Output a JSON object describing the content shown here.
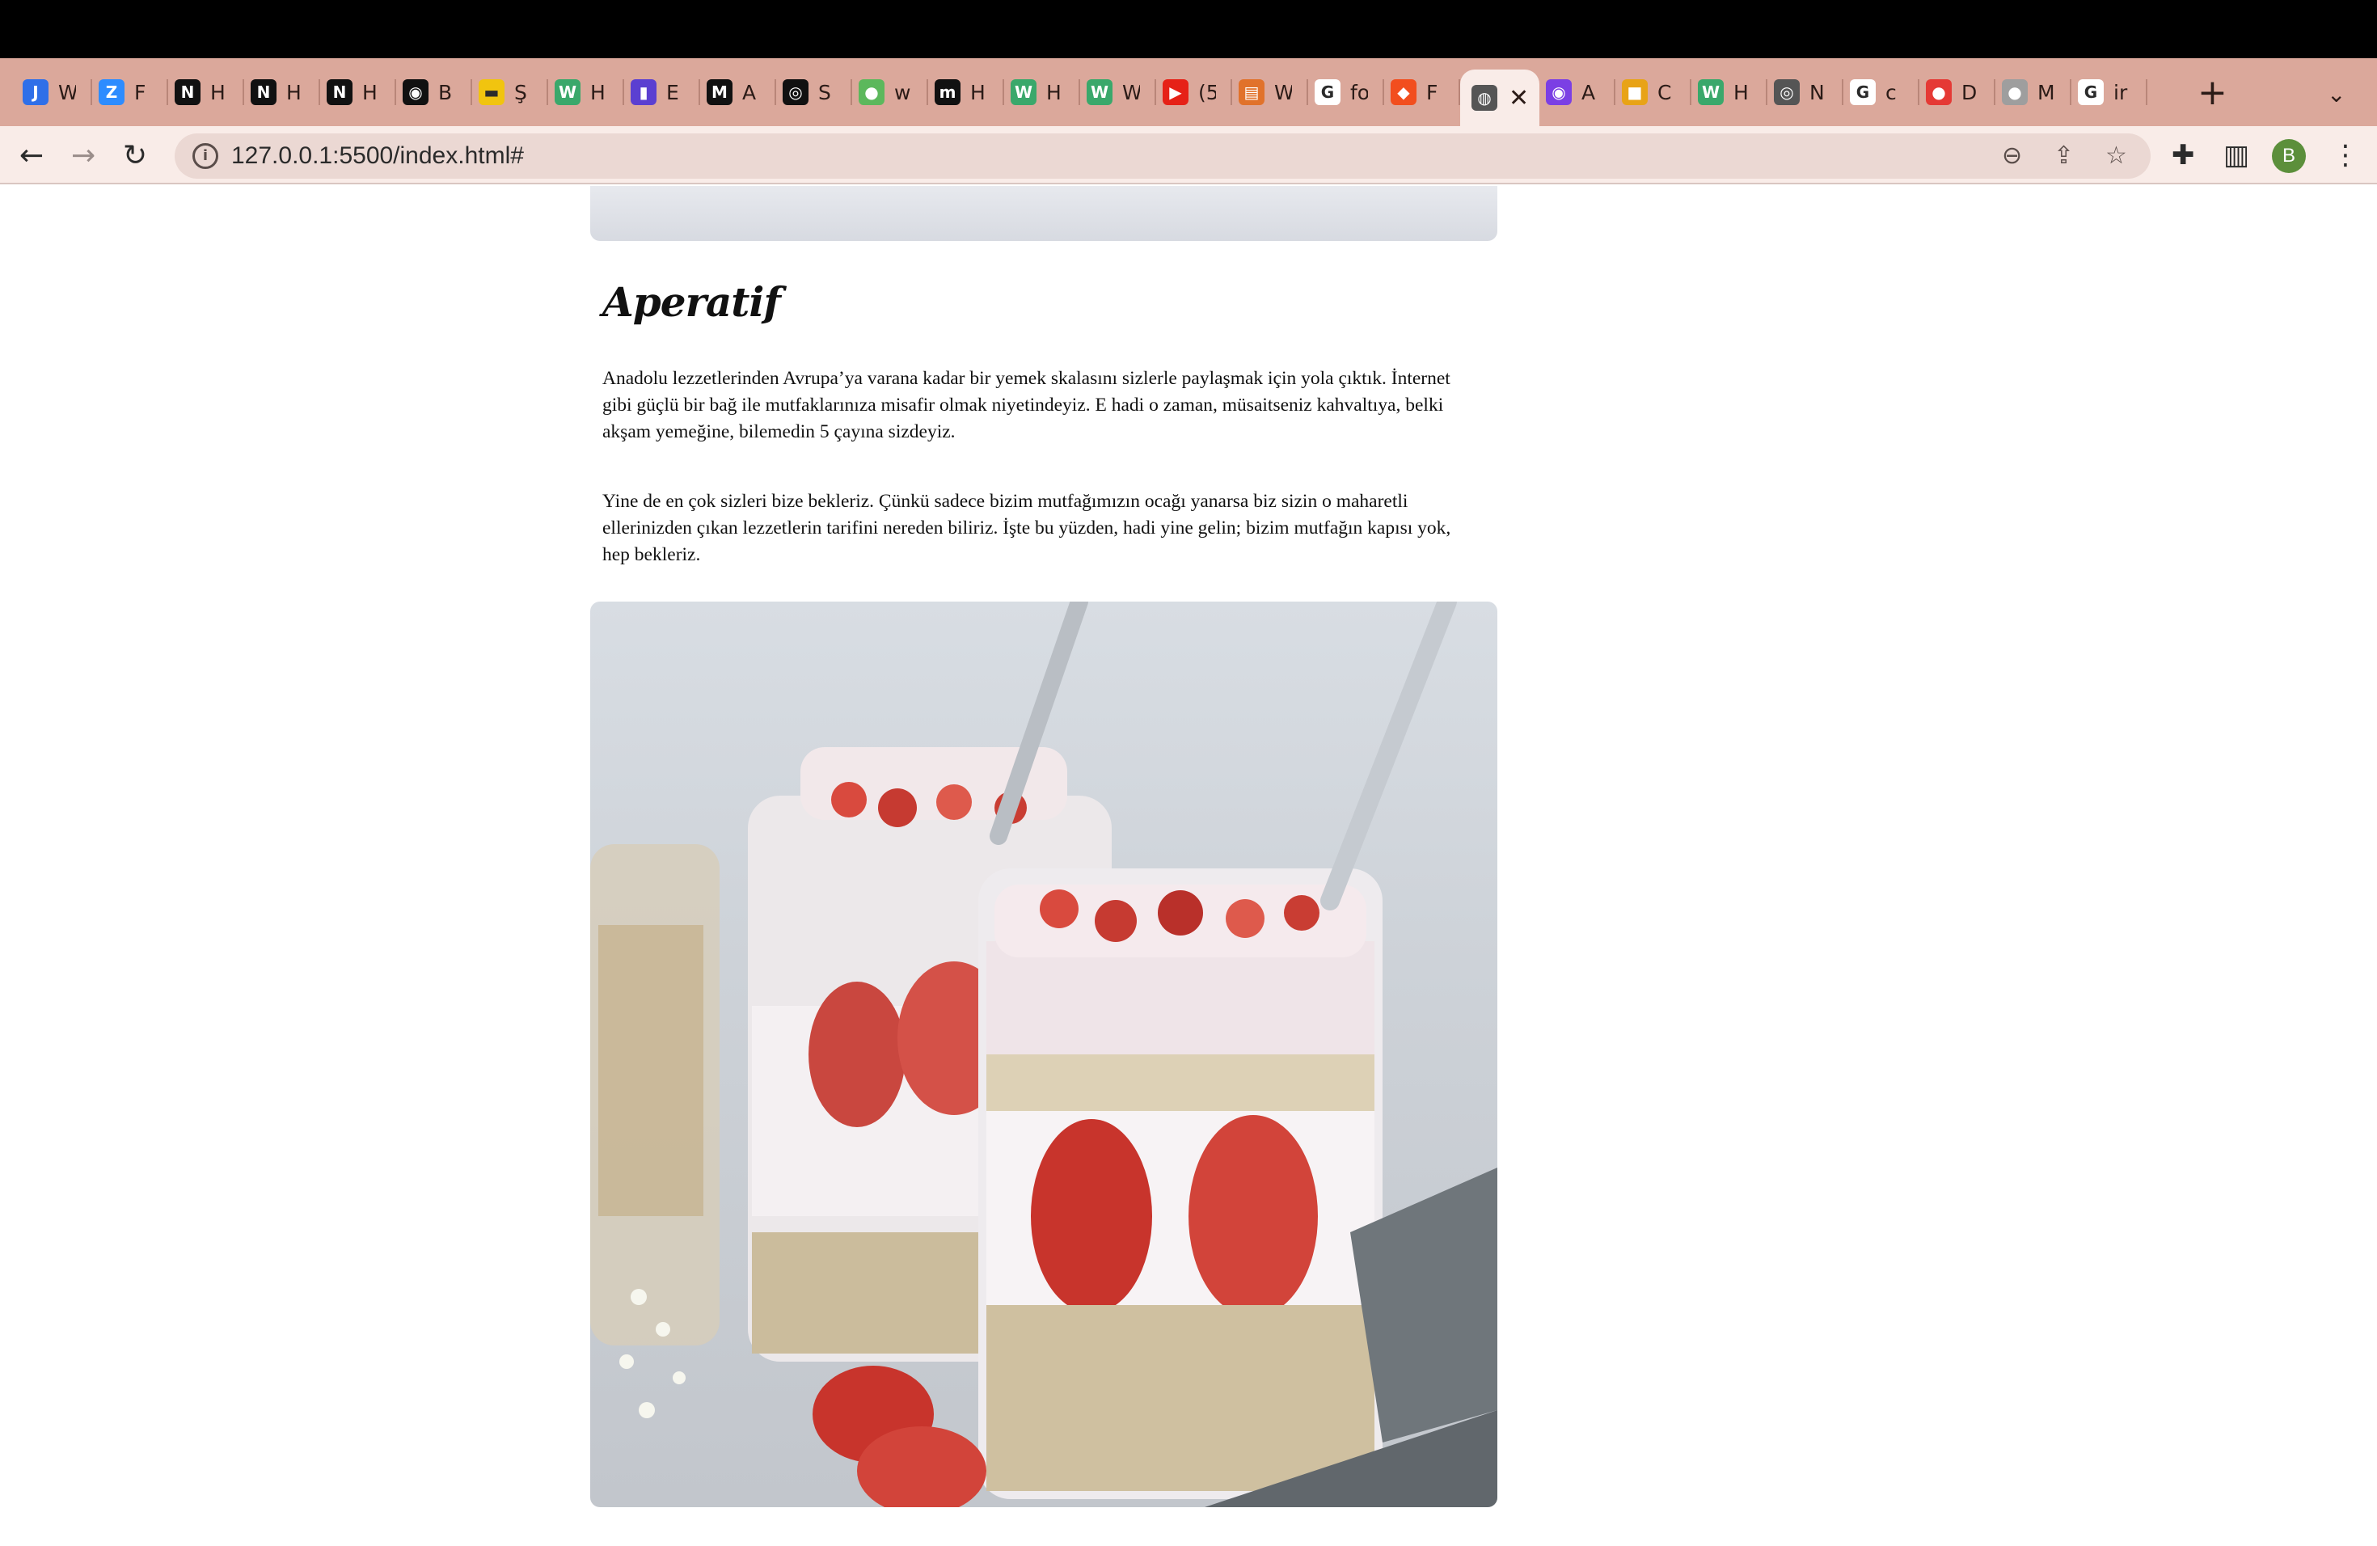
{
  "browser": {
    "tabs": [
      {
        "label": "W",
        "icon": "jira-icon",
        "color": "#2f6fe8",
        "glyph": "J"
      },
      {
        "label": "F",
        "icon": "zoom-icon",
        "color": "#2d8cff",
        "glyph": "Z"
      },
      {
        "label": "H",
        "icon": "notion-icon",
        "color": "#111111",
        "glyph": "N"
      },
      {
        "label": "H",
        "icon": "notion-icon",
        "color": "#111111",
        "glyph": "N"
      },
      {
        "label": "H",
        "icon": "notion-icon",
        "color": "#111111",
        "glyph": "N"
      },
      {
        "label": "B",
        "icon": "github-icon",
        "color": "#111111",
        "glyph": "◉"
      },
      {
        "label": "Ş",
        "icon": "ticket-icon",
        "color": "#f1c40f",
        "glyph": "▬"
      },
      {
        "label": "H",
        "icon": "webflow-icon",
        "color": "#3aa86b",
        "glyph": "W"
      },
      {
        "label": "E",
        "icon": "tool-icon",
        "color": "#5b3fd1",
        "glyph": "▮"
      },
      {
        "label": "A",
        "icon": "medium-icon",
        "color": "#111111",
        "glyph": "M"
      },
      {
        "label": "S",
        "icon": "compass-icon",
        "color": "#111111",
        "glyph": "◎"
      },
      {
        "label": "w",
        "icon": "leaf-icon",
        "color": "#5cb85c",
        "glyph": "●"
      },
      {
        "label": "H",
        "icon": "m-icon",
        "color": "#111111",
        "glyph": "m"
      },
      {
        "label": "H",
        "icon": "webflow-icon",
        "color": "#3aa86b",
        "glyph": "W"
      },
      {
        "label": "W",
        "icon": "webflow-icon",
        "color": "#3aa86b",
        "glyph": "W"
      },
      {
        "label": "(5",
        "icon": "youtube-icon",
        "color": "#e62117",
        "glyph": "▶"
      },
      {
        "label": "W",
        "icon": "burger-icon",
        "color": "#e1722b",
        "glyph": "▤"
      },
      {
        "label": "fo",
        "icon": "google-icon",
        "color": "#ffffff",
        "glyph": "G"
      },
      {
        "label": "F",
        "icon": "figma-icon",
        "color": "#f24e1e",
        "glyph": "◆"
      },
      {
        "label": "",
        "icon": "globe-icon",
        "color": "#555555",
        "glyph": "◍",
        "active": true
      },
      {
        "label": "A",
        "icon": "circle-icon",
        "color": "#7b3fe4",
        "glyph": "◉"
      },
      {
        "label": "C",
        "icon": "palette-icon",
        "color": "#e8a317",
        "glyph": "■"
      },
      {
        "label": "H",
        "icon": "webflow-icon",
        "color": "#3aa86b",
        "glyph": "W"
      },
      {
        "label": "N",
        "icon": "chrome-icon",
        "color": "#555555",
        "glyph": "◎"
      },
      {
        "label": "c",
        "icon": "google-icon",
        "color": "#ffffff",
        "glyph": "G"
      },
      {
        "label": "D",
        "icon": "app-icon",
        "color": "#e53935",
        "glyph": "●"
      },
      {
        "label": "M",
        "icon": "apple-icon",
        "color": "#9e9e9e",
        "glyph": "●"
      },
      {
        "label": "ir",
        "icon": "google-icon",
        "color": "#ffffff",
        "glyph": "G"
      }
    ],
    "new_tab": "+",
    "tab_list": "⌄",
    "url": "127.0.0.1:5500/index.html#",
    "avatar_letter": "B"
  },
  "page": {
    "heading": "Aperatif",
    "paragraph1": "Anadolu lezzetlerinden Avrupa’ya varana kadar bir yemek skalasını sizlerle paylaşmak için yola çıktık. İnternet gibi güçlü bir bağ ile mutfaklarınıza misafir olmak niyetindeyiz. E hadi o zaman, müsaitseniz kahvaltıya, belki akşam yemeğine, bilemedin 5 çayına sizdeyiz.",
    "paragraph2": "Yine de en çok sizleri bize bekleriz. Çünkü sadece bizim mutfağımızın ocağı yanarsa biz sizin o maharetli ellerinizden çıkan lezzetlerin tarifini nereden biliriz. İşte bu yüzden, hadi yine gelin; bizim mutfağın kapısı yok, hep bekleriz."
  }
}
